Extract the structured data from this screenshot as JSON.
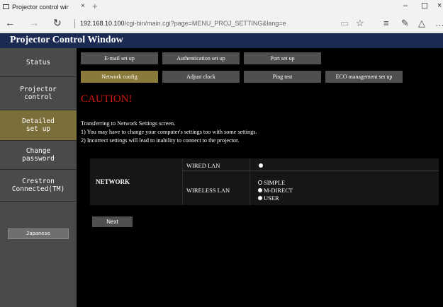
{
  "browser": {
    "tab_title": "Projector control window",
    "tab_close": "×",
    "new_tab": "+",
    "win_min": "–",
    "win_max": "☐",
    "win_close": "×",
    "back": "←",
    "forward": "→",
    "refresh": "↻",
    "url_host": "192.168.10.100",
    "url_path": "/cgi-bin/main.cgi?page=MENU_PROJ_SETTING&lang=e",
    "reading_view": "▭",
    "favorite": "☆",
    "hub": "≡",
    "note": "✎",
    "share": "△",
    "more": "…"
  },
  "app": {
    "title": "Projector Control Window"
  },
  "sidebar": {
    "items": [
      {
        "line1": "Status",
        "line2": ""
      },
      {
        "line1": "Projector",
        "line2": "control"
      },
      {
        "line1": "Detailed",
        "line2": "set up"
      },
      {
        "line1": "Change",
        "line2": "password"
      },
      {
        "line1": "Crestron",
        "line2": "Connected(TM)"
      }
    ],
    "language_button": "Japanese"
  },
  "tabs": {
    "row1": [
      "E-mail set up",
      "Authentication set up",
      "Port set up"
    ],
    "row2": [
      "Network config",
      "Adjust clock",
      "Ping test",
      "ECO management set up"
    ]
  },
  "main": {
    "caution": "CAUTION!",
    "line1": "Transferring to Network Settings screen.",
    "line2": "1)   You may have to change your computer's settings too with some settings.",
    "line3": "2)   Incorrect settings will lead to inability to connect to the projector.",
    "network_label": "NETWORK",
    "wired_label": "WIRED LAN",
    "wireless_label": "WIRELESS LAN",
    "options": [
      "SIMPLE",
      "M-DIRECT",
      "USER"
    ],
    "next_button": "Next"
  },
  "colors": {
    "header_bg": "#1b2a52",
    "sidebar_bg": "#4a4a4a",
    "active_bg": "#7a6e3a",
    "caution": "#d0180b"
  }
}
